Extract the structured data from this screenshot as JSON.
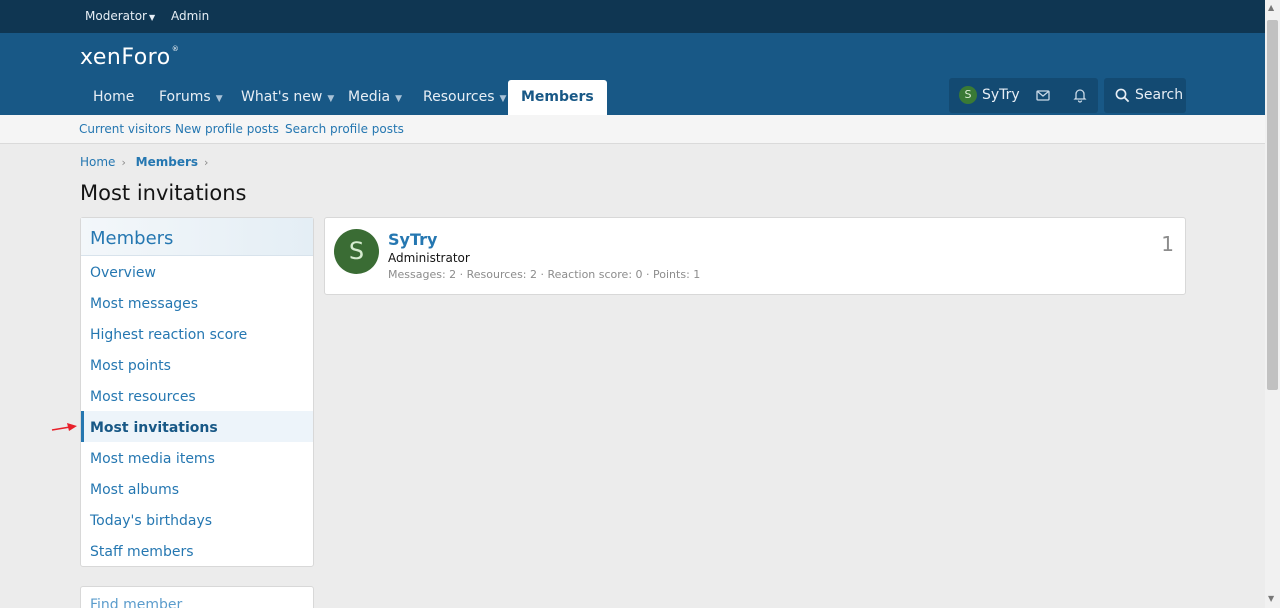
{
  "staff_bar": {
    "moderator_label": "Moderator",
    "admin_label": "Admin"
  },
  "brand": {
    "logo_text": "xenForo"
  },
  "nav": {
    "tabs": [
      {
        "label": "Home"
      },
      {
        "label": "Forums"
      },
      {
        "label": "What's new"
      },
      {
        "label": "Media"
      },
      {
        "label": "Resources"
      },
      {
        "label": "Members"
      }
    ],
    "active_tab": "Members",
    "user": {
      "avatar_letter": "S",
      "name": "SyTry"
    },
    "search_label": "Search"
  },
  "sub_nav": {
    "items": [
      "Current visitors",
      "New profile posts",
      "Search profile posts"
    ]
  },
  "breadcrumb": {
    "items": [
      "Home",
      "Members"
    ]
  },
  "page": {
    "title": "Most invitations"
  },
  "sidebar": {
    "title": "Members",
    "items": [
      "Overview",
      "Most messages",
      "Highest reaction score",
      "Most points",
      "Most resources",
      "Most invitations",
      "Most media items",
      "Most albums",
      "Today's birthdays",
      "Staff members"
    ],
    "selected": "Most invitations"
  },
  "find_member": {
    "title": "Find member"
  },
  "member_list": [
    {
      "avatar_letter": "S",
      "name": "SyTry",
      "role": "Administrator",
      "stats": "Messages: 2 · Resources: 2 · Reaction score: 0 · Points: 1",
      "count": "1"
    }
  ],
  "colors": {
    "header_bg": "#185886",
    "staffbar_bg": "#0f3652",
    "link": "#2577b1",
    "annotation_arrow": "#e8202a"
  }
}
